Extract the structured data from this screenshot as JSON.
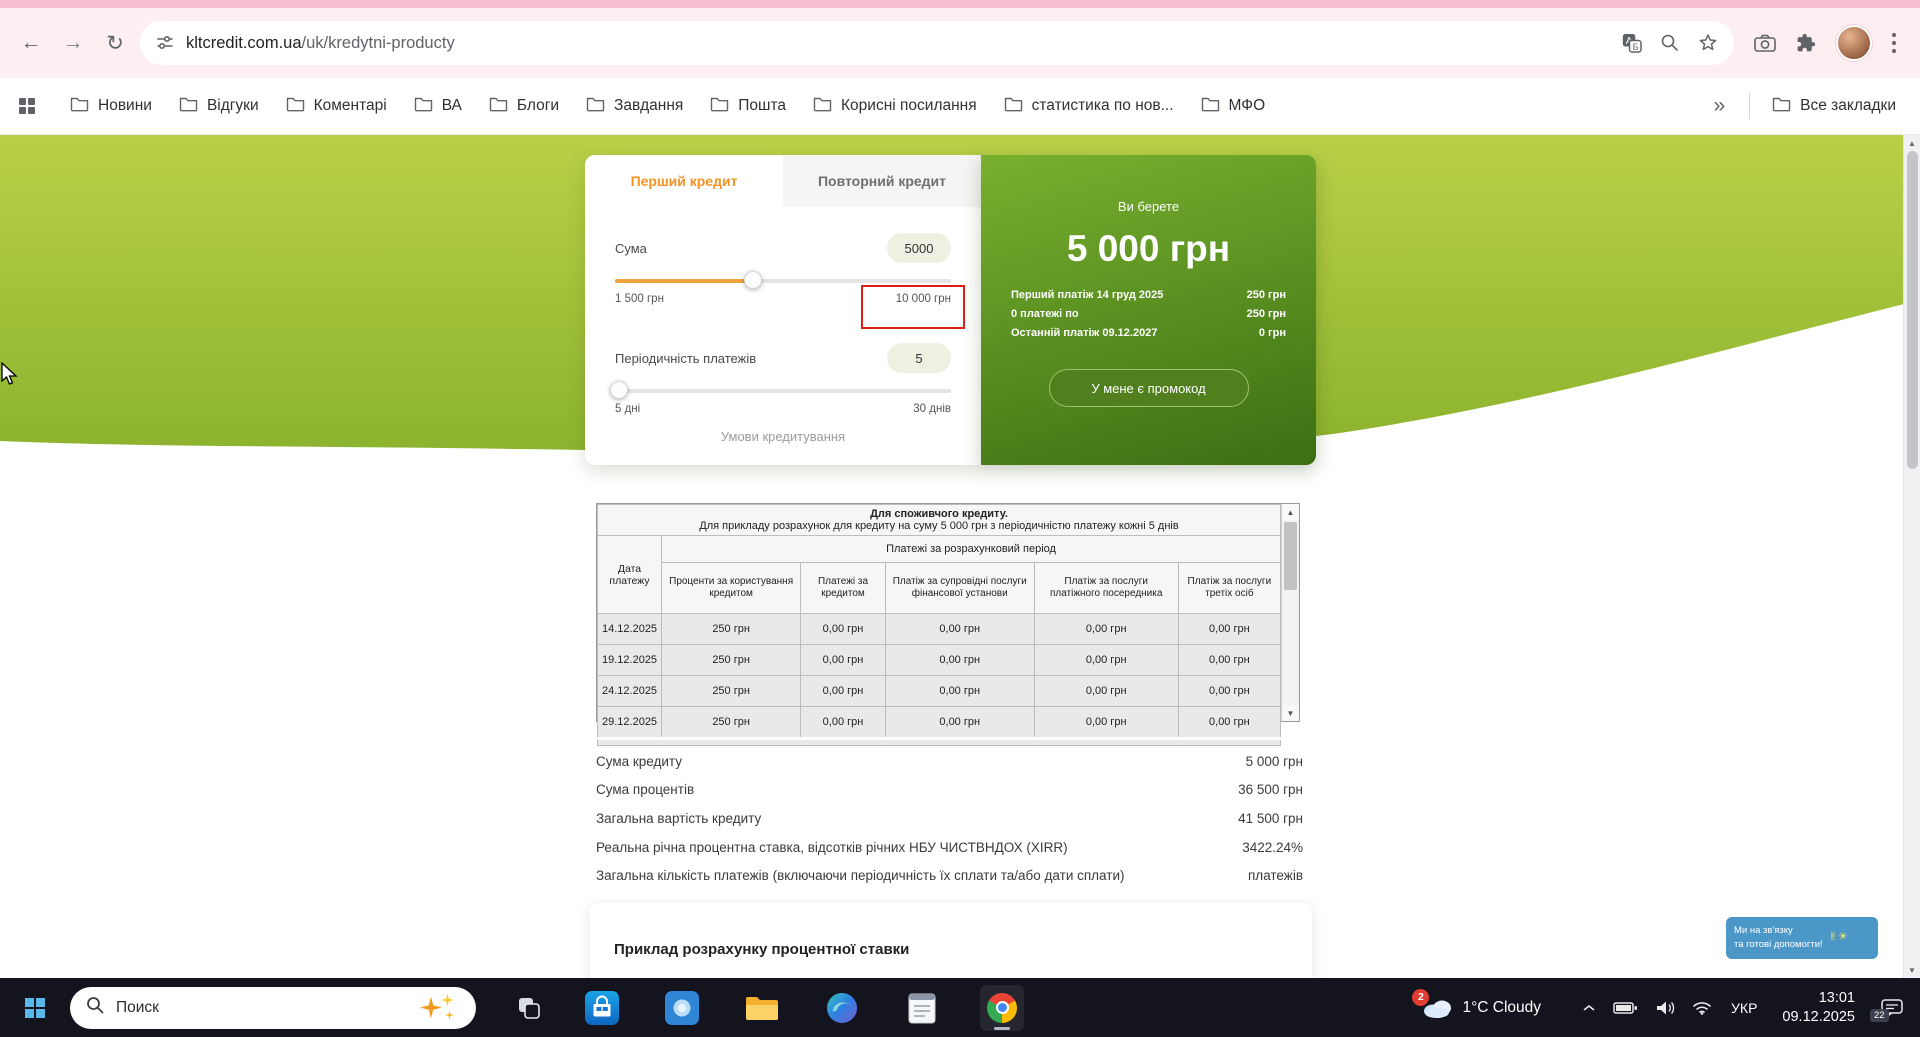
{
  "icons": {
    "back_arrow": "←",
    "forward_arrow": "→",
    "reload": "↻",
    "scroll_up": "▲",
    "scroll_down": "▼"
  },
  "browser": {
    "url_host": "kltcredit.com.ua",
    "url_path": "/uk/kredytni-producty",
    "bookmarks": [
      "Новини",
      "Відгуки",
      "Коментарі",
      "ВА",
      "Блоги",
      "Завдання",
      "Пошта",
      "Корисні посилання",
      "статистика по нов...",
      "МФО"
    ],
    "overflow_chevron": "»",
    "all_bookmarks": "Все закладки"
  },
  "calculator": {
    "tabs": [
      {
        "label": "Перший кредит"
      },
      {
        "label": "Повторний кредит"
      }
    ],
    "amount": {
      "label": "Сума",
      "value": "5000",
      "min": "1 500 грн",
      "max": "10 000 грн"
    },
    "period": {
      "label": "Періодичність платежів",
      "value": "5",
      "min": "5 дні",
      "max": "30 днів"
    },
    "terms_link": "Умови кредитування"
  },
  "result_panel": {
    "title": "Ви берете",
    "amount": "5 000 грн",
    "rows": [
      {
        "label": "Перший платіж 14 груд 2025",
        "value": "250 грн"
      },
      {
        "label": "0 платежі по",
        "value": "250 грн"
      },
      {
        "label": "Останній платіж 09.12.2027",
        "value": "0 грн"
      }
    ],
    "promo_button": "У мене є промокод"
  },
  "schedule": {
    "title": "Для споживчого кредиту.",
    "subtitle": "Для прикладу розрахунок для кредиту на суму 5 000 грн з періодичністю платежу кожні 5 днів",
    "group_header": "Платежі за розрахунковий період",
    "col_date": "Дата платежу",
    "columns": [
      "Проценти за користування кредитом",
      "Платежі за кредитом",
      "Платіж за супровідні послуги фінансової установи",
      "Платіж за послуги платіжного посередника",
      "Платіж за послуги третіх осіб"
    ],
    "rows": [
      [
        "14.12.2025",
        "250 грн",
        "0,00 грн",
        "0,00 грн",
        "0,00 грн",
        "0,00 грн"
      ],
      [
        "19.12.2025",
        "250 грн",
        "0,00 грн",
        "0,00 грн",
        "0,00 грн",
        "0,00 грн"
      ],
      [
        "24.12.2025",
        "250 грн",
        "0,00 грн",
        "0,00 грн",
        "0,00 грн",
        "0,00 грн"
      ],
      [
        "29.12.2025",
        "250 грн",
        "0,00 грн",
        "0,00 грн",
        "0,00 грн",
        "0,00 грн"
      ]
    ]
  },
  "summary": {
    "rows": [
      {
        "label": "Сума кредиту",
        "value": "5 000 грн"
      },
      {
        "label": "Сума процентів",
        "value": "36 500 грн"
      },
      {
        "label": "Загальна вартість кредиту",
        "value": "41 500 грн"
      },
      {
        "label": "Реальна річна процентна ставка, відсотків річних НБУ ЧИСТВНДОХ (XIRR)",
        "value": "3422.24%"
      },
      {
        "label": "Загальна кількість платежів (включаючи періодичність їх сплати та/або дати сплати)",
        "value": "платежів"
      }
    ]
  },
  "example": {
    "title": "Приклад розрахунку процентної ставки"
  },
  "chat": {
    "line1": "Ми на зв'язку",
    "line2": "та готові допомогти!",
    "emoji": "✌☀"
  },
  "taskbar": {
    "search": "Поиск",
    "weather_badge": "2",
    "weather": "1°C Cloudy",
    "language": "УКР",
    "time": "13:01",
    "date": "09.12.2025",
    "notification_badge": "22"
  },
  "colors": {
    "accent_orange": "#f39324",
    "green_dark": "#3c6e13",
    "green_light": "#b7cf47",
    "red_highlight": "#dd1f1a",
    "chrome_pink": "#fdeef2"
  }
}
